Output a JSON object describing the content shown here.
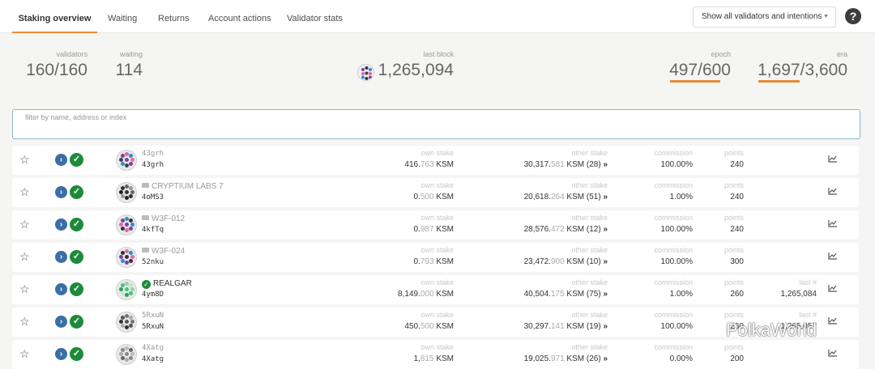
{
  "tabs": [
    {
      "label": "Staking overview",
      "active": true
    },
    {
      "label": "Waiting"
    },
    {
      "label": "Returns"
    },
    {
      "label": "Account actions"
    },
    {
      "label": "Validator stats"
    }
  ],
  "selector": {
    "label": "Show all validators and intentions"
  },
  "help": {
    "label": "?"
  },
  "summary": {
    "validators": {
      "label": "validators",
      "value": "160/160"
    },
    "waiting": {
      "label": "waiting",
      "value": "114"
    },
    "last_block": {
      "label": "last block",
      "value": "1,265,094"
    },
    "epoch": {
      "label": "epoch",
      "value": "497/600",
      "progress": 0.83
    },
    "era": {
      "label": "era",
      "value": "1,697/3,600",
      "progress": 0.47
    }
  },
  "filter": {
    "placeholder": "filter by name, address or index"
  },
  "columns": {
    "own_stake": "own stake",
    "other_stake": "other stake",
    "commission": "commission",
    "points": "points",
    "last": "last #"
  },
  "validators": [
    {
      "name": "43grh",
      "address": "43grh",
      "name_style": "plain",
      "own_stake_int": "416.",
      "own_stake_dec": "763",
      "own_stake_unit": " KSM",
      "other_stake_int": "30,317.",
      "other_stake_dec": "581",
      "other_stake_suffix": " KSM (28)",
      "commission": "100.00%",
      "points": "240",
      "last": ""
    },
    {
      "name": "CRYPTIUM LABS 7",
      "address": "4oMS3",
      "name_style": "tag",
      "own_stake_int": "0.",
      "own_stake_dec": "500",
      "own_stake_unit": " KSM",
      "other_stake_int": "20,618.",
      "other_stake_dec": "264",
      "other_stake_suffix": " KSM (51)",
      "commission": "1.00%",
      "points": "240",
      "last": ""
    },
    {
      "name": "W3F-012",
      "address": "4kfTq",
      "name_style": "tag",
      "own_stake_int": "0.",
      "own_stake_dec": "987",
      "own_stake_unit": " KSM",
      "other_stake_int": "28,576.",
      "other_stake_dec": "472",
      "other_stake_suffix": " KSM (12)",
      "commission": "100.00%",
      "points": "240",
      "last": ""
    },
    {
      "name": "W3F-024",
      "address": "52nku",
      "name_style": "tag",
      "own_stake_int": "0.",
      "own_stake_dec": "793",
      "own_stake_unit": " KSM",
      "other_stake_int": "23,472.",
      "other_stake_dec": "900",
      "other_stake_suffix": " KSM (10)",
      "commission": "100.00%",
      "points": "300",
      "last": ""
    },
    {
      "name": "REALGAR",
      "address": "4ym8D",
      "name_style": "verified",
      "own_stake_int": "8,149.",
      "own_stake_dec": "000",
      "own_stake_unit": " KSM",
      "other_stake_int": "40,504.",
      "other_stake_dec": "175",
      "other_stake_suffix": " KSM (75)",
      "commission": "1.00%",
      "points": "260",
      "last": "1,265,084"
    },
    {
      "name": "5RxuN",
      "address": "5RxuN",
      "name_style": "plain",
      "own_stake_int": "450.",
      "own_stake_dec": "500",
      "own_stake_unit": " KSM",
      "other_stake_int": "30,297.",
      "other_stake_dec": "141",
      "other_stake_suffix": " KSM (19)",
      "commission": "100.00%",
      "points": "260",
      "last": "1,265,057"
    },
    {
      "name": "4Xatg",
      "address": "4Xatg",
      "name_style": "plain",
      "own_stake_int": "1,",
      "own_stake_dec": "815",
      "own_stake_unit": " KSM",
      "other_stake_int": "19,025.",
      "other_stake_dec": "971",
      "other_stake_suffix": " KSM (26)",
      "commission": "0.00%",
      "points": "200",
      "last": ""
    }
  ],
  "watermark": {
    "text": "PolkaWorld"
  }
}
